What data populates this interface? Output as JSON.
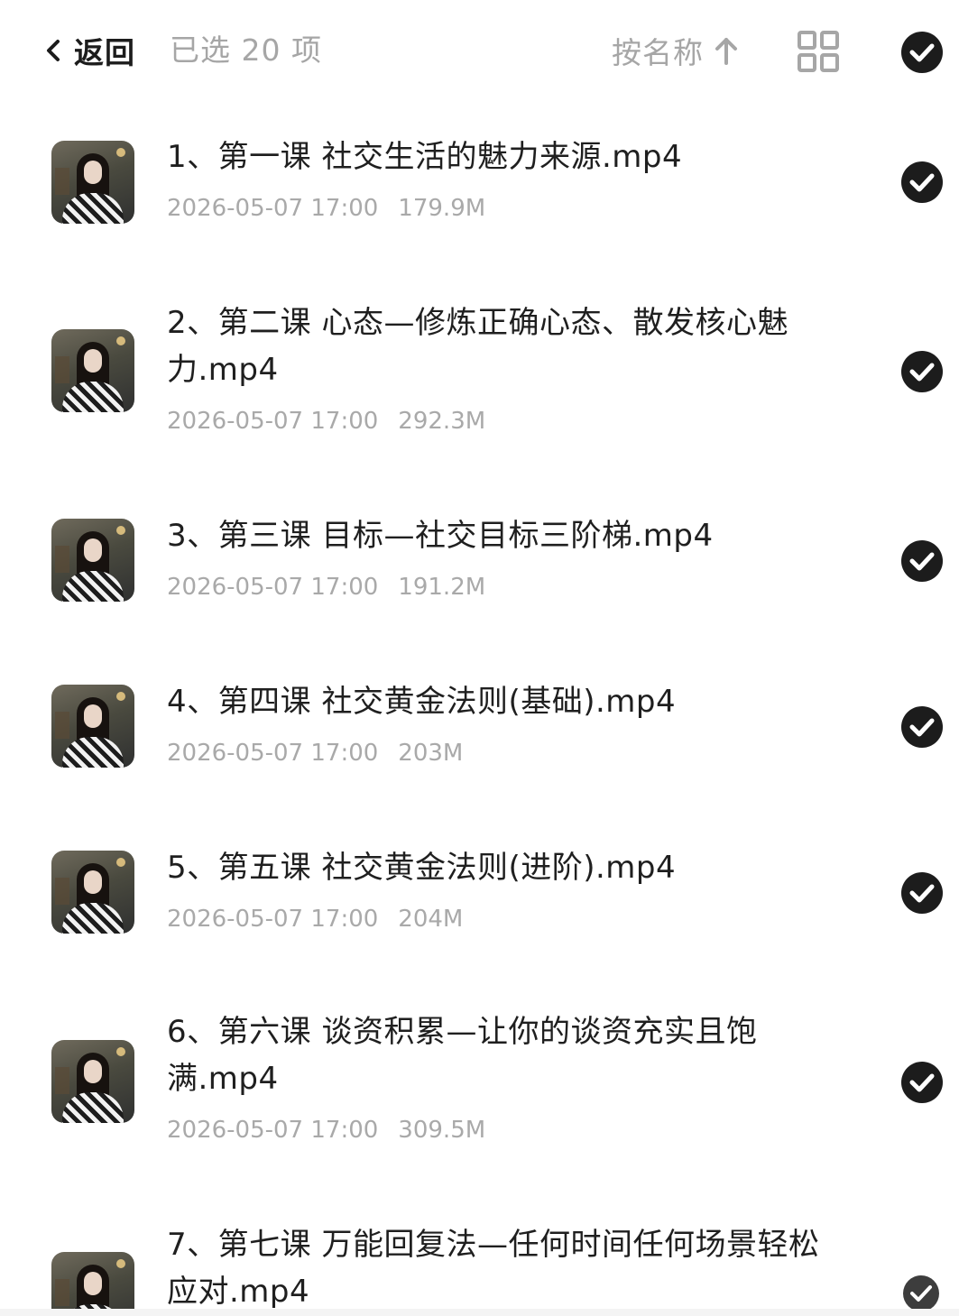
{
  "header": {
    "back_label": "返回",
    "selected_text": "已选 20 项",
    "sort_label": "按名称",
    "sort_direction_icon": "arrow-up-icon",
    "view_toggle_icon": "grid-view-icon",
    "select_all_icon": "check-circle-icon"
  },
  "files": [
    {
      "title": "1、第一课 社交生活的魅力来源.mp4",
      "date": "2026-05-07 17:00",
      "size": "179.9M",
      "selected": true
    },
    {
      "title": "2、第二课 心态—修炼正确心态、散发核心魅力.mp4",
      "date": "2026-05-07 17:00",
      "size": "292.3M",
      "selected": true
    },
    {
      "title": "3、第三课 目标—社交目标三阶梯.mp4",
      "date": "2026-05-07 17:00",
      "size": "191.2M",
      "selected": true
    },
    {
      "title": "4、第四课 社交黄金法则(基础).mp4",
      "date": "2026-05-07 17:00",
      "size": "203M",
      "selected": true
    },
    {
      "title": "5、第五课 社交黄金法则(进阶).mp4",
      "date": "2026-05-07 17:00",
      "size": "204M",
      "selected": true
    },
    {
      "title": "6、第六课 谈资积累—让你的谈资充实且饱满.mp4",
      "date": "2026-05-07 17:00",
      "size": "309.5M",
      "selected": true
    },
    {
      "title": "7、第七课 万能回复法—任何时间任何场景轻松应对.mp4",
      "date": "",
      "size": "",
      "selected": true
    }
  ],
  "colors": {
    "check_fill": "#1c1c1c",
    "secondary_text": "#a6a6a6",
    "primary_text": "#1f1f1f"
  }
}
